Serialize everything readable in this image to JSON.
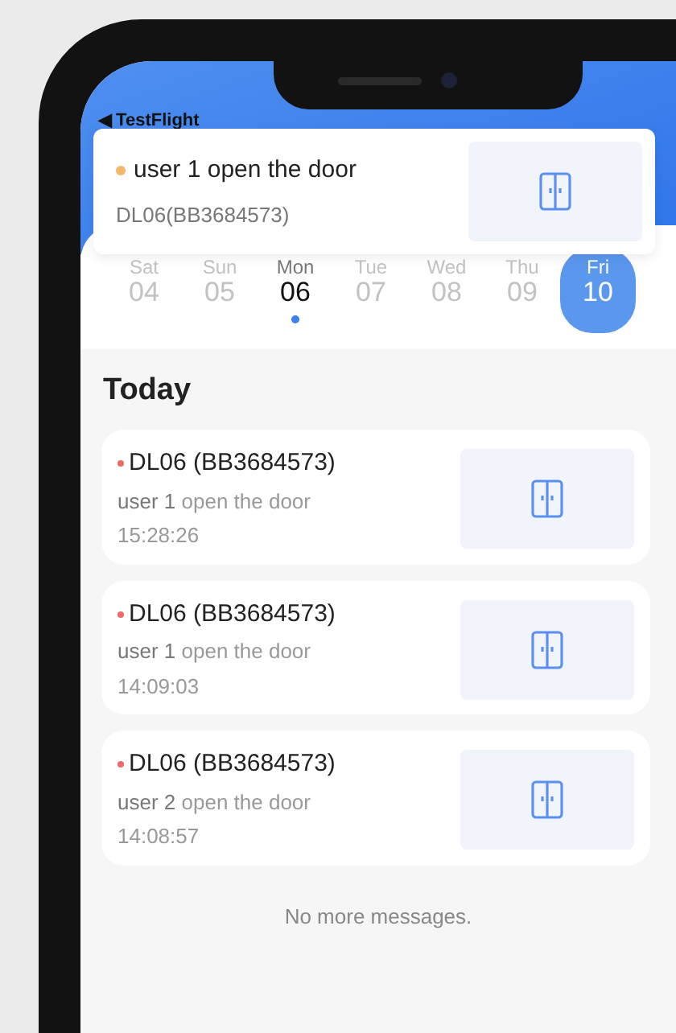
{
  "status_bar": {
    "back_label": "◀ TestFlight"
  },
  "notification": {
    "title": "user 1 open the door",
    "subtitle": "DL06(BB3684573)",
    "color": "#f5b86a"
  },
  "week": [
    {
      "day": "Sat",
      "date": "04",
      "selected": false,
      "today": false
    },
    {
      "day": "Sun",
      "date": "05",
      "selected": false,
      "today": false
    },
    {
      "day": "Mon",
      "date": "06",
      "selected": false,
      "today": true
    },
    {
      "day": "Tue",
      "date": "07",
      "selected": false,
      "today": false
    },
    {
      "day": "Wed",
      "date": "08",
      "selected": false,
      "today": false
    },
    {
      "day": "Thu",
      "date": "09",
      "selected": false,
      "today": false
    },
    {
      "day": "Fri",
      "date": "10",
      "selected": true,
      "today": false
    }
  ],
  "section_title": "Today",
  "messages": [
    {
      "device": "DL06 (BB3684573)",
      "user": "user 1",
      "action": "open the door",
      "time": "15:28:26",
      "color": "#f06a6a"
    },
    {
      "device": "DL06 (BB3684573)",
      "user": "user 1",
      "action": "open the door",
      "time": "14:09:03",
      "color": "#f06a6a"
    },
    {
      "device": "DL06 (BB3684573)",
      "user": "user 2",
      "action": "open the door",
      "time": "14:08:57",
      "color": "#f06a6a"
    }
  ],
  "footer": "No more messages."
}
